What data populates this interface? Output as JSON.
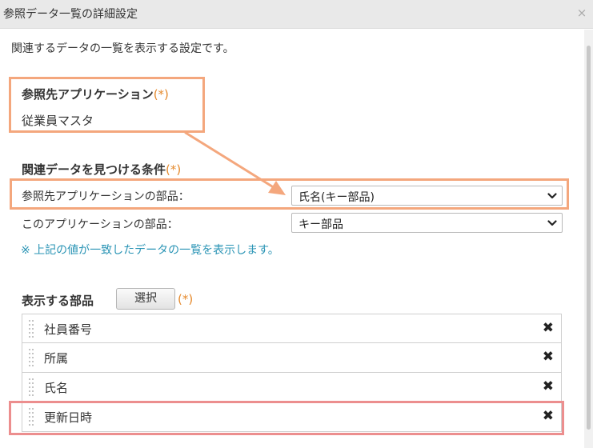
{
  "dialog": {
    "title": "参照データ一覧の詳細設定",
    "close_icon": "×"
  },
  "description": "関連するデータの一覧を表示する設定です。",
  "reference_app": {
    "heading": "参照先アプリケーション",
    "required_mark": "(*)",
    "value": "従業員マスタ"
  },
  "conditions": {
    "heading": "関連データを見つける条件",
    "required_mark": "(*)",
    "rows": [
      {
        "label": "参照先アプリケーションの部品：",
        "selected": "氏名(キー部品)"
      },
      {
        "label": "このアプリケーションの部品：",
        "selected": "キー部品"
      }
    ],
    "note": "※ 上記の値が一致したデータの一覧を表示します。"
  },
  "display_fields": {
    "heading": "表示する部品",
    "select_button": "選択",
    "required_mark": "(*)",
    "delete_icon": "✖",
    "items": [
      "社員番号",
      "所属",
      "氏名",
      "更新日時"
    ]
  },
  "colors": {
    "highlight_orange": "#f4a77d",
    "highlight_red": "#ec8e8e",
    "required_orange": "#e58a2d",
    "note_blue": "#2a94b5"
  }
}
